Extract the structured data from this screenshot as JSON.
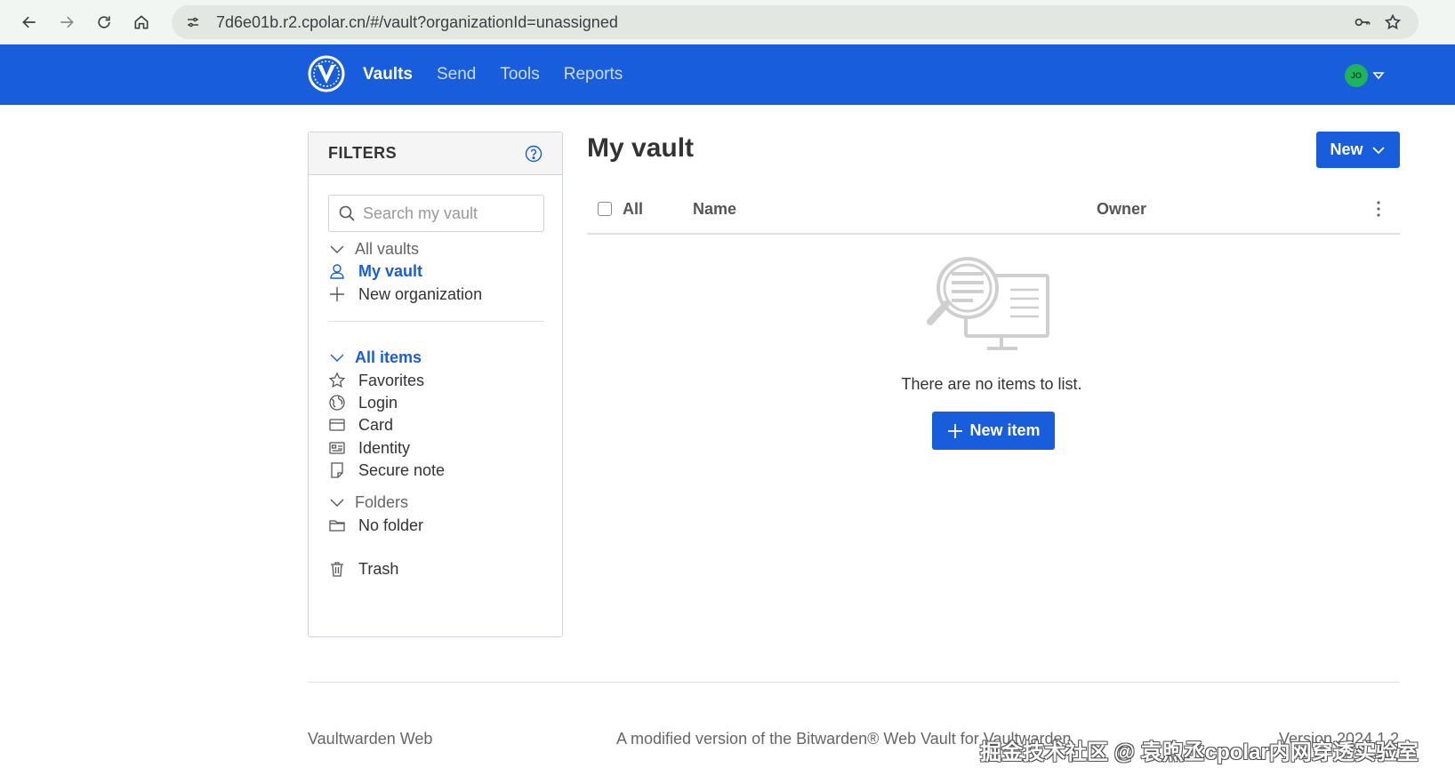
{
  "browser": {
    "url": "7d6e01b.r2.cpolar.cn/#/vault?organizationId=unassigned"
  },
  "header": {
    "nav": [
      "Vaults",
      "Send",
      "Tools",
      "Reports"
    ],
    "active_nav": "Vaults",
    "avatar_initials": "JO",
    "brand_color": "#175ddc",
    "avatar_color": "#1fb35b"
  },
  "filters": {
    "title": "FILTERS",
    "search_placeholder": "Search my vault",
    "vaults_heading": "All vaults",
    "my_vault": "My vault",
    "new_organization": "New organization",
    "items_heading": "All items",
    "favorites": "Favorites",
    "login": "Login",
    "card": "Card",
    "identity": "Identity",
    "secure_note": "Secure note",
    "folders_heading": "Folders",
    "no_folder": "No folder",
    "trash": "Trash"
  },
  "main": {
    "title": "My vault",
    "new_button": "New",
    "col_all": "All",
    "col_name": "Name",
    "col_owner": "Owner",
    "empty_text": "There are no items to list.",
    "new_item_button": "New item"
  },
  "footer": {
    "left": "Vaultwarden Web",
    "middle": "A modified version of the Bitwarden® Web Vault for Vaultwarden",
    "right": "Version 2024.1.2"
  },
  "watermark": "掘金技术社区 @ 袁煦丞cpolar内网穿透实验室"
}
